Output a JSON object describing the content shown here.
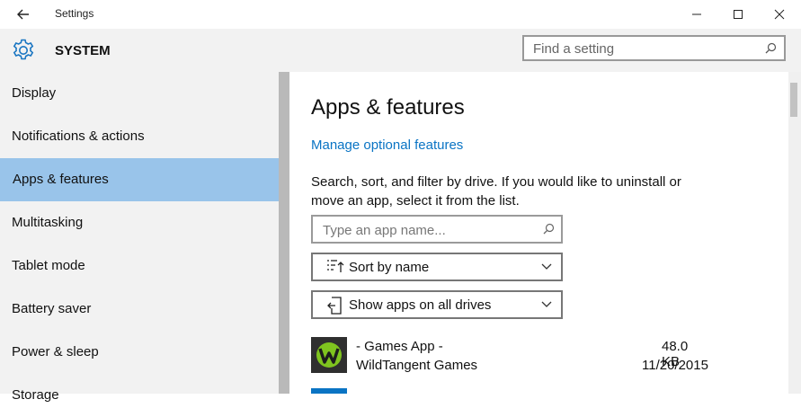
{
  "window": {
    "title": "Settings",
    "minimize_label": "Minimize",
    "maximize_label": "Maximize",
    "close_label": "Close"
  },
  "header": {
    "section_title": "SYSTEM",
    "search_placeholder": "Find a setting"
  },
  "sidebar": {
    "items": [
      {
        "label": "Display",
        "selected": false
      },
      {
        "label": "Notifications & actions",
        "selected": false
      },
      {
        "label": "Apps & features",
        "selected": true
      },
      {
        "label": "Multitasking",
        "selected": false
      },
      {
        "label": "Tablet mode",
        "selected": false
      },
      {
        "label": "Battery saver",
        "selected": false
      },
      {
        "label": "Power & sleep",
        "selected": false
      },
      {
        "label": "Storage",
        "selected": false
      }
    ]
  },
  "main": {
    "title": "Apps & features",
    "manage_link": "Manage optional features",
    "description": "Search, sort, and filter by drive. If you would like to uninstall or move an app, select it from the list.",
    "search_placeholder": "Type an app name...",
    "sort_label": "Sort by name",
    "filter_label": "Show apps on all drives",
    "apps": [
      {
        "name": "- Games App -",
        "publisher": "WildTangent Games",
        "size": "48.0 KB",
        "date": "11/20/2015"
      }
    ]
  },
  "colors": {
    "accent": "#0a74c4",
    "selected_bg": "#99c4ea",
    "sidebar_bg": "#f2f2f2"
  }
}
